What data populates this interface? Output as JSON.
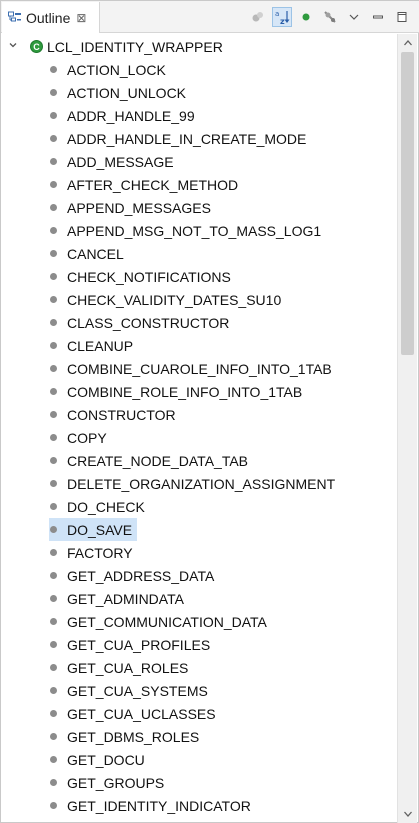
{
  "tab": {
    "title": "Outline",
    "close": "⊠"
  },
  "toolbar": {
    "buttons": [
      {
        "name": "hide-fields-icon"
      },
      {
        "name": "sort-az-icon",
        "active": true,
        "label_a": "a",
        "label_z": "z"
      },
      {
        "name": "hide-nonpublic-icon"
      },
      {
        "name": "hide-static-icon"
      },
      {
        "name": "view-menu-icon"
      },
      {
        "name": "minimize-icon"
      },
      {
        "name": "maximize-icon"
      }
    ]
  },
  "tree": {
    "root": {
      "label": "LCL_IDENTITY_WRAPPER",
      "icon": "class-icon",
      "icon_glyph": "C",
      "expanded": true
    },
    "items": [
      {
        "label": "ACTION_LOCK"
      },
      {
        "label": "ACTION_UNLOCK"
      },
      {
        "label": "ADDR_HANDLE_99"
      },
      {
        "label": "ADDR_HANDLE_IN_CREATE_MODE"
      },
      {
        "label": "ADD_MESSAGE"
      },
      {
        "label": "AFTER_CHECK_METHOD"
      },
      {
        "label": "APPEND_MESSAGES"
      },
      {
        "label": "APPEND_MSG_NOT_TO_MASS_LOG1"
      },
      {
        "label": "CANCEL"
      },
      {
        "label": "CHECK_NOTIFICATIONS"
      },
      {
        "label": "CHECK_VALIDITY_DATES_SU10"
      },
      {
        "label": "CLASS_CONSTRUCTOR"
      },
      {
        "label": "CLEANUP"
      },
      {
        "label": "COMBINE_CUAROLE_INFO_INTO_1TAB"
      },
      {
        "label": "COMBINE_ROLE_INFO_INTO_1TAB"
      },
      {
        "label": "CONSTRUCTOR"
      },
      {
        "label": "COPY"
      },
      {
        "label": "CREATE_NODE_DATA_TAB"
      },
      {
        "label": "DELETE_ORGANIZATION_ASSIGNMENT"
      },
      {
        "label": "DO_CHECK"
      },
      {
        "label": "DO_SAVE",
        "selected": true
      },
      {
        "label": "FACTORY"
      },
      {
        "label": "GET_ADDRESS_DATA"
      },
      {
        "label": "GET_ADMINDATA"
      },
      {
        "label": "GET_COMMUNICATION_DATA"
      },
      {
        "label": "GET_CUA_PROFILES"
      },
      {
        "label": "GET_CUA_ROLES"
      },
      {
        "label": "GET_CUA_SYSTEMS"
      },
      {
        "label": "GET_CUA_UCLASSES"
      },
      {
        "label": "GET_DBMS_ROLES"
      },
      {
        "label": "GET_DOCU"
      },
      {
        "label": "GET_GROUPS"
      },
      {
        "label": "GET_IDENTITY_INDICATOR"
      }
    ]
  },
  "colors": {
    "selection": "#cfe3f7",
    "class_icon": "#2f9a3e",
    "method_dot": "#8c8c8c"
  }
}
